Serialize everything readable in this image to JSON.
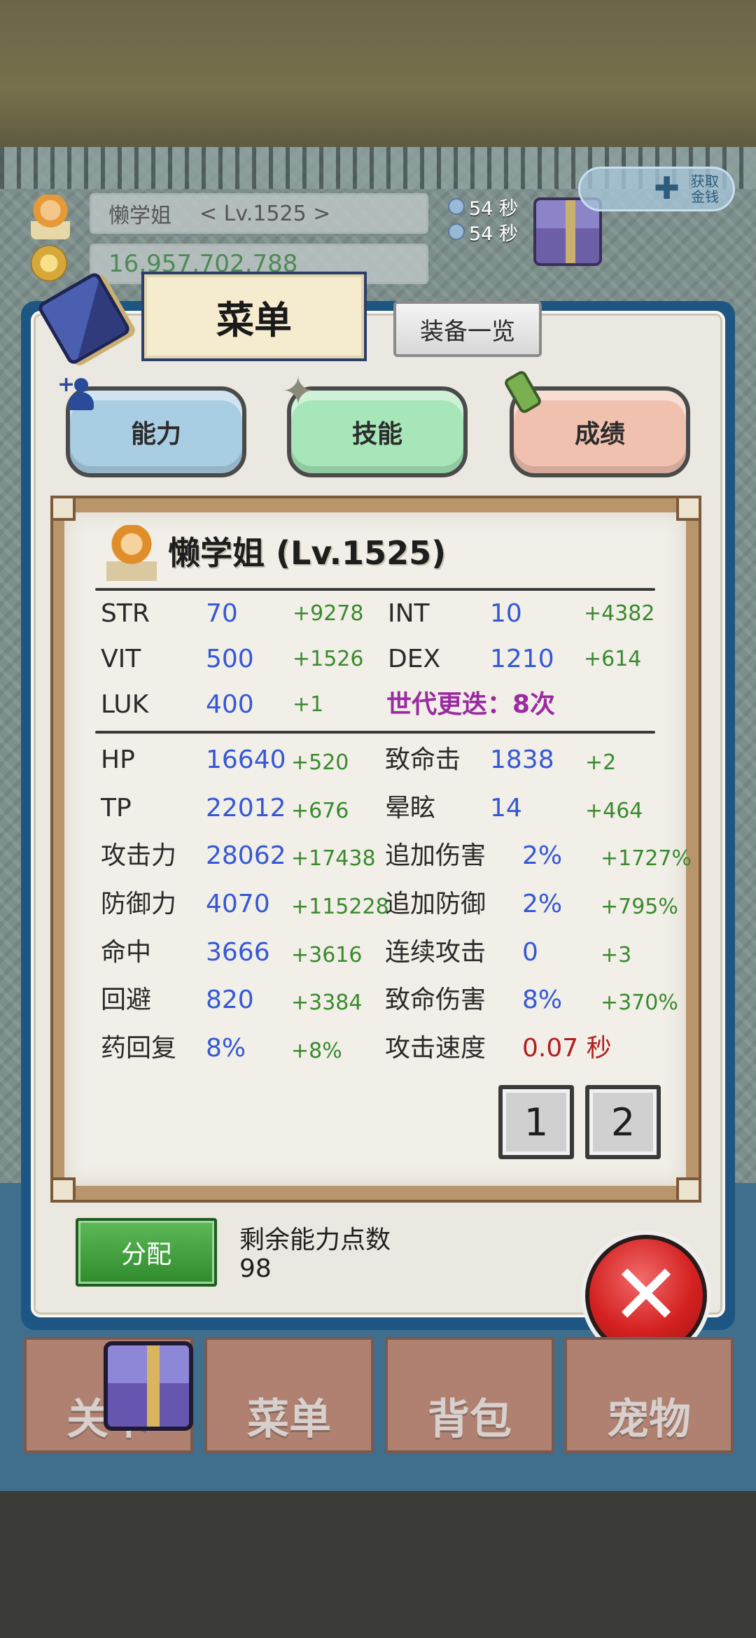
{
  "hud": {
    "player_name": "懒学姐",
    "player_level": "< Lv.1525 >",
    "gold": "16,957,702,788",
    "timer1": "54 秒",
    "timer2": "54 秒",
    "get_label": "获取金钱"
  },
  "header": {
    "title": "菜单",
    "equip_button": "装备一览"
  },
  "categories": [
    {
      "label": "能力"
    },
    {
      "label": "技能"
    },
    {
      "label": "成绩"
    }
  ],
  "character": {
    "name_level": "懒学姐 (Lv.1525)"
  },
  "base_stats": {
    "str": {
      "label": "STR",
      "value": "70",
      "bonus": "+9278"
    },
    "int": {
      "label": "INT",
      "value": "10",
      "bonus": "+4382"
    },
    "vit": {
      "label": "VIT",
      "value": "500",
      "bonus": "+1526"
    },
    "dex": {
      "label": "DEX",
      "value": "1210",
      "bonus": "+614"
    },
    "luk": {
      "label": "LUK",
      "value": "400",
      "bonus": "+1"
    },
    "generation": "世代更迭：8次"
  },
  "combat_stats": {
    "hp": {
      "label": "HP",
      "value": "16640",
      "bonus": "+520"
    },
    "crit": {
      "label": "致命击",
      "value": "1838",
      "bonus": "+2"
    },
    "tp": {
      "label": "TP",
      "value": "22012",
      "bonus": "+676"
    },
    "stun": {
      "label": "晕眩",
      "value": "14",
      "bonus": "+464"
    },
    "atk": {
      "label": "攻击力",
      "value": "28062",
      "bonus": "+17438"
    },
    "extra_dmg": {
      "label": "追加伤害",
      "value": "2%",
      "bonus": "+1727%"
    },
    "def": {
      "label": "防御力",
      "value": "4070",
      "bonus": "+115228"
    },
    "extra_def": {
      "label": "追加防御",
      "value": "2%",
      "bonus": "+795%"
    },
    "hit": {
      "label": "命中",
      "value": "3666",
      "bonus": "+3616"
    },
    "combo": {
      "label": "连续攻击",
      "value": "0",
      "bonus": "+3"
    },
    "evade": {
      "label": "回避",
      "value": "820",
      "bonus": "+3384"
    },
    "crit_dmg": {
      "label": "致命伤害",
      "value": "8%",
      "bonus": "+370%"
    },
    "potion": {
      "label": "药回复",
      "value": "8%",
      "bonus": "+8%"
    },
    "atk_speed": {
      "label": "攻击速度",
      "value": "0.07 秒"
    }
  },
  "pages": [
    "1",
    "2"
  ],
  "footer": {
    "allocate_button": "分配",
    "remaining_label": "剩余能力点数",
    "remaining_value": "98"
  },
  "bottom_nav": [
    "关卡",
    "菜单",
    "背包",
    "宠物"
  ]
}
